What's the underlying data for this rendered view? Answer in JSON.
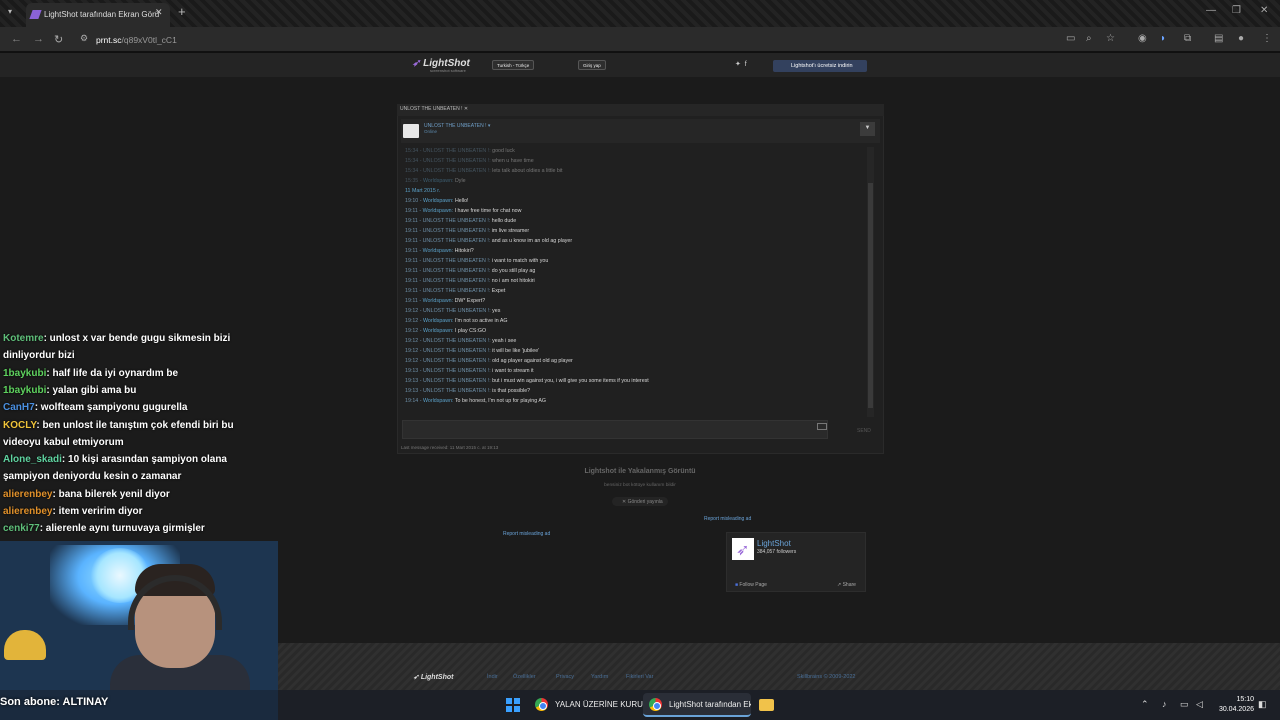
{
  "browser": {
    "tab_title": "LightShot tarafından Ekran Görü",
    "url_host": "prnt.sc",
    "url_path": "/q89xV0tl_cC1"
  },
  "lightshot": {
    "logo": "LightShot",
    "logo_sub": "screenshot software",
    "lang_button": "Turkish - Türkçe",
    "login_button": "Giriş yap",
    "download_button": "Lightshot'ı ücretsiz indirin",
    "caption": "Lightshot ile Yakalanmış Görüntü",
    "meta": "bensiniz bot   kötüye kullanım bildir",
    "share_button": "Gönderi yayınla",
    "report_ad_1": "Report misleading ad",
    "report_ad_2": "Report misleading ad",
    "fb_name": "LightShot",
    "fb_followers": "384,057 followers",
    "fb_follow": "Follow Page",
    "fb_share": "Share",
    "footer": {
      "logo": "LightShot",
      "links": [
        "İndir",
        "Özellikler",
        "Privacy",
        "Yardım",
        "Fikirleri Var"
      ],
      "copyright_link": "Skillbrains",
      "copyright": " © 2009-2022"
    }
  },
  "screenshot": {
    "window_tab": "UNLOST THE UNBEATEN !",
    "chat_name": "UNLOST THE UNBEATEN !",
    "chat_status": "Online",
    "last_message": "Last message received: 11 Mart 2015 c. at 19:13",
    "send": "SEND",
    "messages": [
      {
        "t": "15:34",
        "n": "UNLOST THE UNBEATEN !",
        "w": false,
        "x": "good luck"
      },
      {
        "t": "15:34",
        "n": "UNLOST THE UNBEATEN !",
        "w": false,
        "x": "when u have time"
      },
      {
        "t": "15:34",
        "n": "UNLOST THE UNBEATEN !",
        "w": false,
        "x": "lets talk about oldies a little bit"
      },
      {
        "t": "15:35",
        "n": "Worldspawn",
        "w": true,
        "x": "Dyle"
      },
      {
        "t": "",
        "n": "11 Mart 2015 r.",
        "w": true,
        "x": ""
      },
      {
        "t": "19:10",
        "n": "Worldspawn",
        "w": true,
        "x": "Hello!"
      },
      {
        "t": "19:11",
        "n": "Worldspawn",
        "w": true,
        "x": "I have free time for chat now"
      },
      {
        "t": "19:11",
        "n": "UNLOST THE UNBEATEN !",
        "w": false,
        "x": "hello dude"
      },
      {
        "t": "19:11",
        "n": "UNLOST THE UNBEATEN !",
        "w": false,
        "x": "im live streamer"
      },
      {
        "t": "19:11",
        "n": "UNLOST THE UNBEATEN !",
        "w": false,
        "x": "and as u know im an old ag player"
      },
      {
        "t": "19:11",
        "n": "Worldspawn",
        "w": true,
        "x": "Hitokiri?"
      },
      {
        "t": "19:11",
        "n": "UNLOST THE UNBEATEN !",
        "w": false,
        "x": "i want to match with you"
      },
      {
        "t": "19:11",
        "n": "UNLOST THE UNBEATEN !",
        "w": false,
        "x": "do you still play ag"
      },
      {
        "t": "19:11",
        "n": "UNLOST THE UNBEATEN !",
        "w": false,
        "x": "no i am not hitokiri"
      },
      {
        "t": "19:11",
        "n": "UNLOST THE UNBEATEN !",
        "w": false,
        "x": "Expet"
      },
      {
        "t": "19:11",
        "n": "Worldspawn",
        "w": true,
        "x": "DW* Expert?"
      },
      {
        "t": "19:12",
        "n": "UNLOST THE UNBEATEN !",
        "w": false,
        "x": "yes"
      },
      {
        "t": "19:12",
        "n": "Worldspawn",
        "w": true,
        "x": "I'm not so active in AG"
      },
      {
        "t": "19:12",
        "n": "Worldspawn",
        "w": true,
        "x": "I play CS:GO"
      },
      {
        "t": "19:12",
        "n": "UNLOST THE UNBEATEN !",
        "w": false,
        "x": "yeah i see"
      },
      {
        "t": "19:12",
        "n": "UNLOST THE UNBEATEN !",
        "w": false,
        "x": "it will be like 'jubilee'"
      },
      {
        "t": "19:12",
        "n": "UNLOST THE UNBEATEN !",
        "w": false,
        "x": "old ag player against old ag player"
      },
      {
        "t": "19:13",
        "n": "UNLOST THE UNBEATEN !",
        "w": false,
        "x": "i want to stream it"
      },
      {
        "t": "19:13",
        "n": "UNLOST THE UNBEATEN !",
        "w": false,
        "x": "but i must win against you, i will give you some items if you interest"
      },
      {
        "t": "19:13",
        "n": "UNLOST THE UNBEATEN !",
        "w": false,
        "x": "is that possible?"
      },
      {
        "t": "19:14",
        "n": "Worldspawn",
        "w": true,
        "x": "To be honest, I'm not up for playing AG"
      }
    ]
  },
  "overlay": {
    "messages": [
      {
        "u": "Kotemre",
        "c": "#5fbf7a",
        "x": ": unlost x var bende gugu sikmesin bizi"
      },
      {
        "u": "",
        "c": "#ffffff",
        "x": "dinliyordur bizi"
      },
      {
        "u": "1baykubi",
        "c": "#5fd35f",
        "x": ": half life da iyi oynardım be"
      },
      {
        "u": "1baykubi",
        "c": "#5fd35f",
        "x": ": yalan gibi ama bu"
      },
      {
        "u": "CanH7",
        "c": "#4a8fe0",
        "x": ": wolfteam şampiyonu gugurella"
      },
      {
        "u": "KOCLY",
        "c": "#f0c43a",
        "x": ": ben unlost ile tanıştım çok efendi biri bu"
      },
      {
        "u": "",
        "c": "#ffffff",
        "x": "videoyu kabul etmiyorum"
      },
      {
        "u": "Alone_skadi",
        "c": "#5fd3a0",
        "x": ": 10 kişi arasından şampiyon olana"
      },
      {
        "u": "",
        "c": "#ffffff",
        "x": "şampiyon deniyordu kesin o zamanar"
      },
      {
        "u": "alierenbey",
        "c": "#e0902a",
        "x": ": bana bilerek yenil diyor"
      },
      {
        "u": "alierenbey",
        "c": "#e0902a",
        "x": ": item veririm diyor"
      },
      {
        "u": "cenki77",
        "c": "#5fbf7a",
        "x": ": alierenle aynı turnuvaya girmişler"
      }
    ],
    "subscriber": "Son abone: ALTINAY"
  },
  "taskbar": {
    "app1": "YALAN ÜZERİNE KURUL",
    "app2": "LightShot tarafından Ekı",
    "time": "15:10",
    "date": "30.04.2026"
  }
}
